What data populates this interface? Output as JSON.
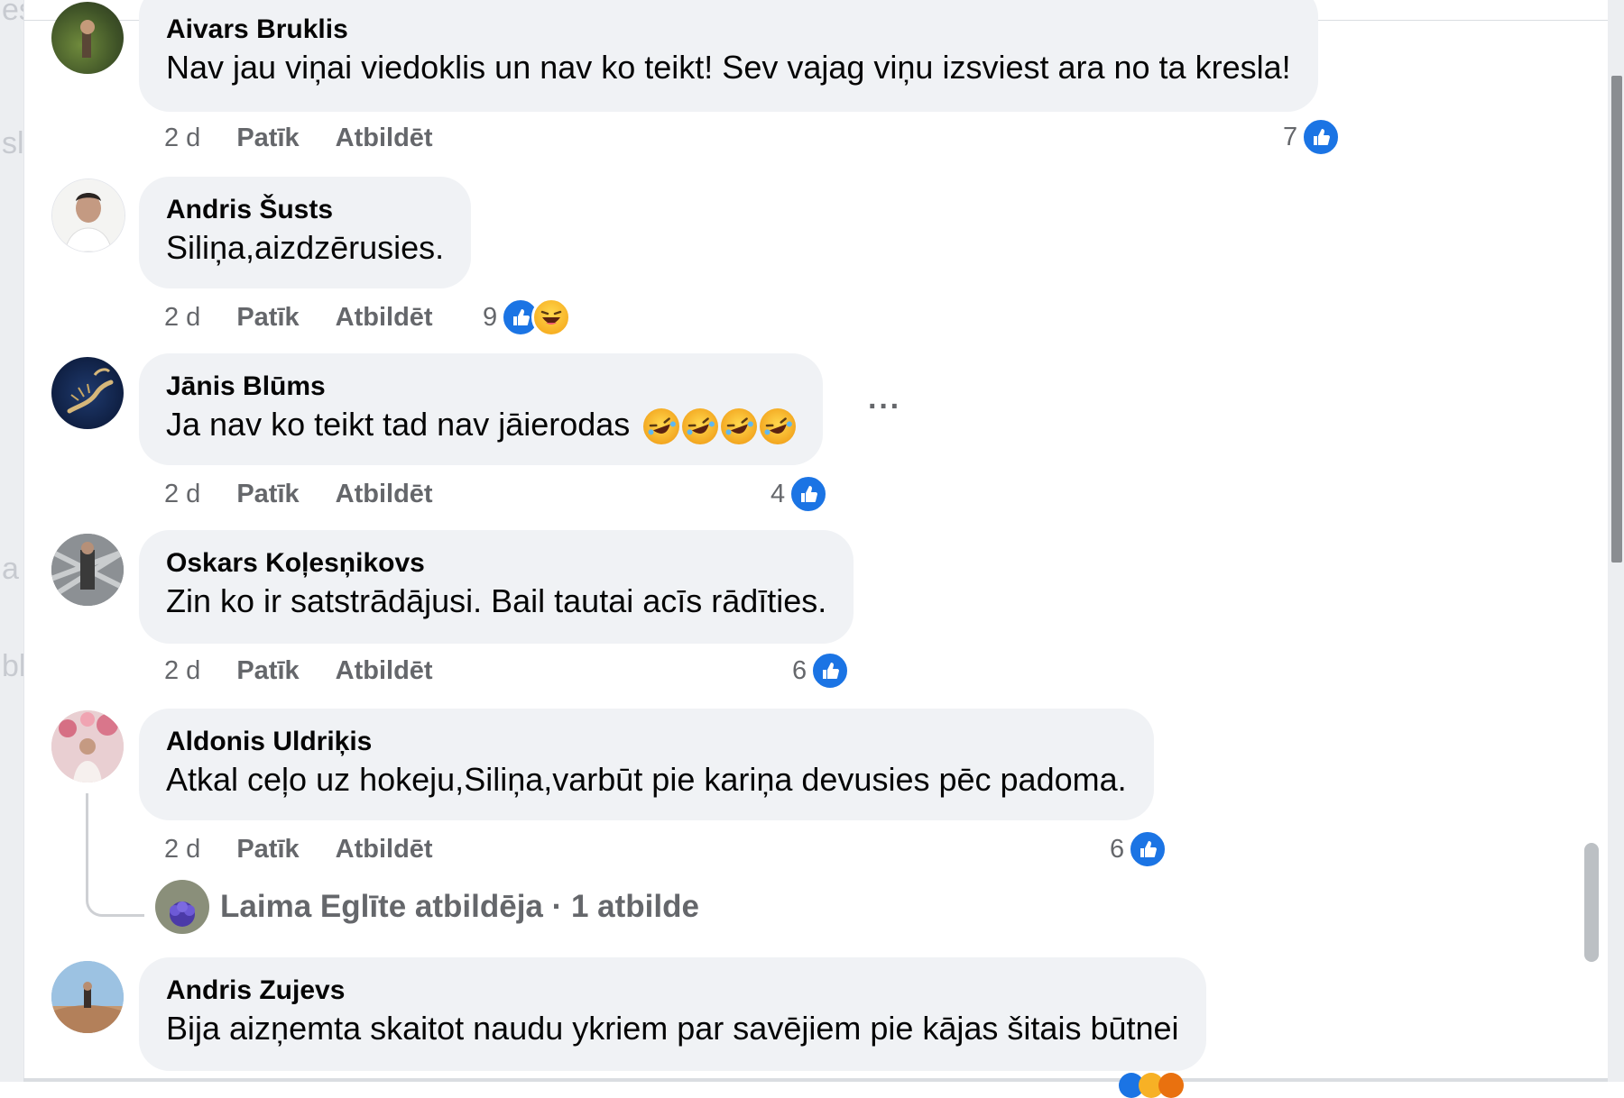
{
  "left_ghost_text": [
    "es",
    "sl",
    "a",
    "bl"
  ],
  "comments": [
    {
      "author": "Aivars Bruklis",
      "text": "Nav jau viņai viedoklis un nav ko teikt! Sev vajag viņu izsviest ara no ta kresla!",
      "time": "2 d",
      "like_label": "Patīk",
      "reply_label": "Atbildēt",
      "reaction_count": "7",
      "reactions": [
        "like"
      ]
    },
    {
      "author": "Andris Šusts",
      "text": "Siliņa,aizdzērusies.",
      "time": "2 d",
      "like_label": "Patīk",
      "reply_label": "Atbildēt",
      "reaction_count": "9",
      "reactions": [
        "like",
        "haha"
      ]
    },
    {
      "author": "Jānis Blūms",
      "text": "Ja nav ko teikt tad nav jāierodas",
      "text_emojis": [
        "rolling-laughing",
        "rolling-laughing",
        "rolling-laughing",
        "rolling-laughing"
      ],
      "time": "2 d",
      "like_label": "Patīk",
      "reply_label": "Atbildēt",
      "reaction_count": "4",
      "reactions": [
        "like"
      ],
      "more_label": "···"
    },
    {
      "author": "Oskars Koļesņikovs",
      "text": "Zin ko ir satstrādājusi. Bail tautai acīs rādīties.",
      "time": "2 d",
      "like_label": "Patīk",
      "reply_label": "Atbildēt",
      "reaction_count": "6",
      "reactions": [
        "like"
      ]
    },
    {
      "author": "Aldonis Uldriķis",
      "text": "Atkal ceļo uz hokeju,Siliņa,varbūt pie kariņa devusies pēc padoma.",
      "time": "2 d",
      "like_label": "Patīk",
      "reply_label": "Atbildēt",
      "reaction_count": "6",
      "reactions": [
        "like"
      ],
      "reply_summary": "Laima Eglīte atbildēja · 1 atbilde"
    },
    {
      "author": "Andris Zujevs",
      "text": "Bija aizņemta skaitot naudu ykriem par savējiem pie kājas šitais būtnei"
    }
  ],
  "colors": {
    "like_blue": "#1b74e4",
    "bubble_bg": "#f0f2f5",
    "meta_gray": "#65676b",
    "text_dark": "#050505"
  }
}
